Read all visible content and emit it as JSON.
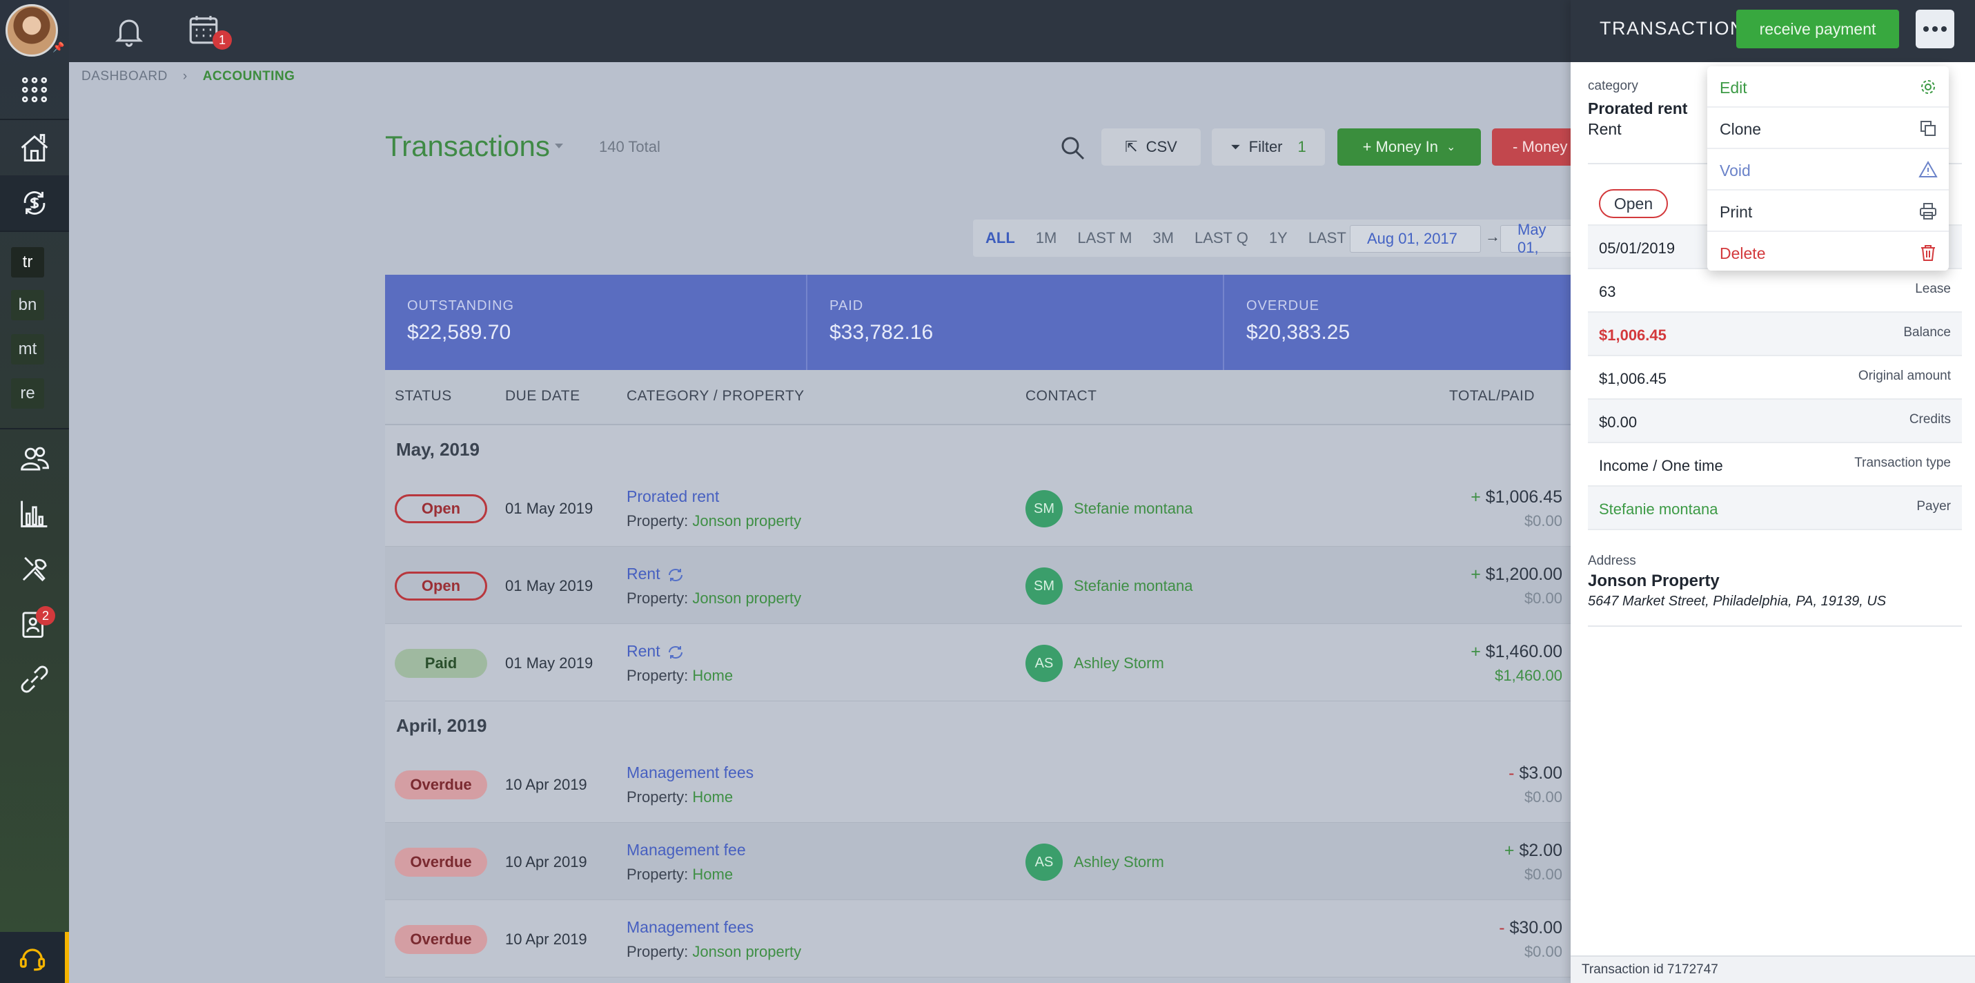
{
  "topbar": {
    "calendar_badge": "1"
  },
  "sidebar": {
    "tags": [
      "tr",
      "bn",
      "mt",
      "re"
    ],
    "badge_contacts": "2",
    "colors": {
      "accent": "#f5b400"
    }
  },
  "breadcrumb": {
    "items": [
      "DASHBOARD",
      "ACCOUNTING"
    ]
  },
  "header": {
    "title": "Transactions",
    "total": "140 Total",
    "csv_label": "CSV",
    "filter_label": "Filter",
    "filter_count": "1",
    "money_in_label": "+ Money In",
    "money_out_label": "- Money"
  },
  "range": {
    "options": [
      "ALL",
      "1M",
      "LAST M",
      "3M",
      "LAST Q",
      "1Y",
      "LAST Y"
    ],
    "from": "Aug 01, 2017",
    "to": "May 01,"
  },
  "summary": [
    {
      "label": "OUTSTANDING",
      "value": "$22,589.70"
    },
    {
      "label": "PAID",
      "value": "$33,782.16"
    },
    {
      "label": "OVERDUE",
      "value": "$20,383.25"
    }
  ],
  "table": {
    "columns": [
      "STATUS",
      "DUE DATE",
      "CATEGORY / PROPERTY",
      "CONTACT",
      "TOTAL/PAID"
    ],
    "property_prefix": "Property:",
    "groups": [
      {
        "month": "May, 2019",
        "rows": [
          {
            "status": "Open",
            "due": "01 May 2019",
            "category": "Prorated rent",
            "property": "Jonson property",
            "initials": "SM",
            "contact": "Stefanie montana",
            "sign": "+",
            "total": "$1,006.45",
            "paid": "$0.00"
          },
          {
            "status": "Open",
            "due": "01 May 2019",
            "category": "Rent",
            "property": "Jonson property",
            "initials": "SM",
            "contact": "Stefanie montana",
            "sign": "+",
            "total": "$1,200.00",
            "paid": "$0.00"
          },
          {
            "status": "Paid",
            "due": "01 May 2019",
            "category": "Rent",
            "property": "Home",
            "initials": "AS",
            "contact": "Ashley Storm",
            "sign": "+",
            "total": "$1,460.00",
            "paid": "$1,460.00"
          }
        ]
      },
      {
        "month": "April, 2019",
        "rows": [
          {
            "status": "Overdue",
            "due": "10 Apr 2019",
            "category": "Management fees",
            "property": "Home",
            "initials": "",
            "contact": "",
            "sign": "-",
            "total": "$3.00",
            "paid": "$0.00"
          },
          {
            "status": "Overdue",
            "due": "10 Apr 2019",
            "category": "Management fee",
            "property": "Home",
            "initials": "AS",
            "contact": "Ashley Storm",
            "sign": "+",
            "total": "$2.00",
            "paid": "$0.00"
          },
          {
            "status": "Overdue",
            "due": "10 Apr 2019",
            "category": "Management fees",
            "property": "Jonson property",
            "initials": "",
            "contact": "",
            "sign": "-",
            "total": "$30.00",
            "paid": "$0.00"
          }
        ]
      }
    ]
  },
  "drawer": {
    "title": "TRANSACTION",
    "receive_label": "receive payment",
    "category_label": "category",
    "category_main": "Prorated rent",
    "category_sub": "Rent",
    "status": "Open",
    "details": [
      {
        "value": "05/01/2019",
        "key": ""
      },
      {
        "value": "63",
        "key": "Lease"
      },
      {
        "value": "$1,006.45",
        "key": "Balance"
      },
      {
        "value": "$1,006.45",
        "key": "Original amount"
      },
      {
        "value": "$0.00",
        "key": "Credits"
      },
      {
        "value": "Income / One time",
        "key": "Transaction type"
      },
      {
        "value": "Stefanie montana",
        "key": "Payer"
      }
    ],
    "address_label": "Address",
    "address_name": "Jonson Property",
    "address_line": "5647 Market Street, Philadelphia, PA, 19139, US",
    "footer": "Transaction id 7172747"
  },
  "menu": {
    "items": [
      {
        "label": "Edit",
        "icon": "gear-icon"
      },
      {
        "label": "Clone",
        "icon": "copy-icon"
      },
      {
        "label": "Void",
        "icon": "warning-icon"
      },
      {
        "label": "Print",
        "icon": "printer-icon"
      },
      {
        "label": "Delete",
        "icon": "trash-icon"
      }
    ]
  }
}
